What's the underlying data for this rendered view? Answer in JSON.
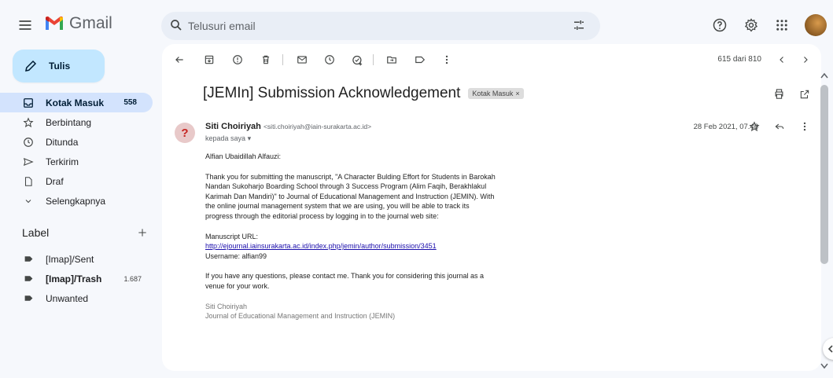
{
  "app": {
    "name": "Gmail"
  },
  "search": {
    "placeholder": "Telusuri email"
  },
  "compose": {
    "label": "Tulis"
  },
  "sidebar": {
    "items": [
      {
        "label": "Kotak Masuk",
        "count": "558",
        "icon": "inbox-icon",
        "active": true
      },
      {
        "label": "Berbintang",
        "icon": "star-icon"
      },
      {
        "label": "Ditunda",
        "icon": "clock-icon"
      },
      {
        "label": "Terkirim",
        "icon": "send-icon"
      },
      {
        "label": "Draf",
        "icon": "draft-icon"
      },
      {
        "label": "Selengkapnya",
        "icon": "chevron-down-icon"
      }
    ],
    "label_header": "Label",
    "labels": [
      {
        "label": "[Imap]/Sent"
      },
      {
        "label": "[Imap]/Trash",
        "count": "1.687",
        "bold": true
      },
      {
        "label": "Unwanted"
      }
    ]
  },
  "toolbar": {
    "pager": "615 dari 810"
  },
  "email": {
    "subject": "[JEMIn] Submission Acknowledgement",
    "chip": "Kotak Masuk",
    "chip_close": "×",
    "sender_name": "Siti Choiriyah",
    "sender_email": "<siti.choiriyah@iain-surakarta.ac.id>",
    "to": "kepada saya",
    "date": "28 Feb 2021, 07.46",
    "greeting": "Alfian Ubaidillah Alfauzi:",
    "para1": "Thank you for submitting the manuscript, \"A Character Bulding Effort for Students in Barokah Nandan Sukoharjo Boarding School through 3 Success Program (Alim Faqih, Berakhlakul Karimah Dan Mandiri)\" to Journal of Educational Management and Instruction (JEMIN). With the online journal management system that we are using, you will be able to track its progress through the editorial process by logging in to the journal web site:",
    "url_label": "Manuscript URL:",
    "url": "http://ejournal.iainsurakarta.ac.id/index.php/jemin/author/submission/3451",
    "username": "Username: alfian99",
    "para2": "If you have any questions, please contact me. Thank you for considering this journal as a venue for your work.",
    "sig_name": "Siti Choiriyah",
    "sig_org": "Journal of Educational Management and Instruction (JEMIN)"
  },
  "colors": {
    "accent": "#c2e7ff",
    "active_nav": "#d3e3fd",
    "link": "#1a0dab"
  }
}
